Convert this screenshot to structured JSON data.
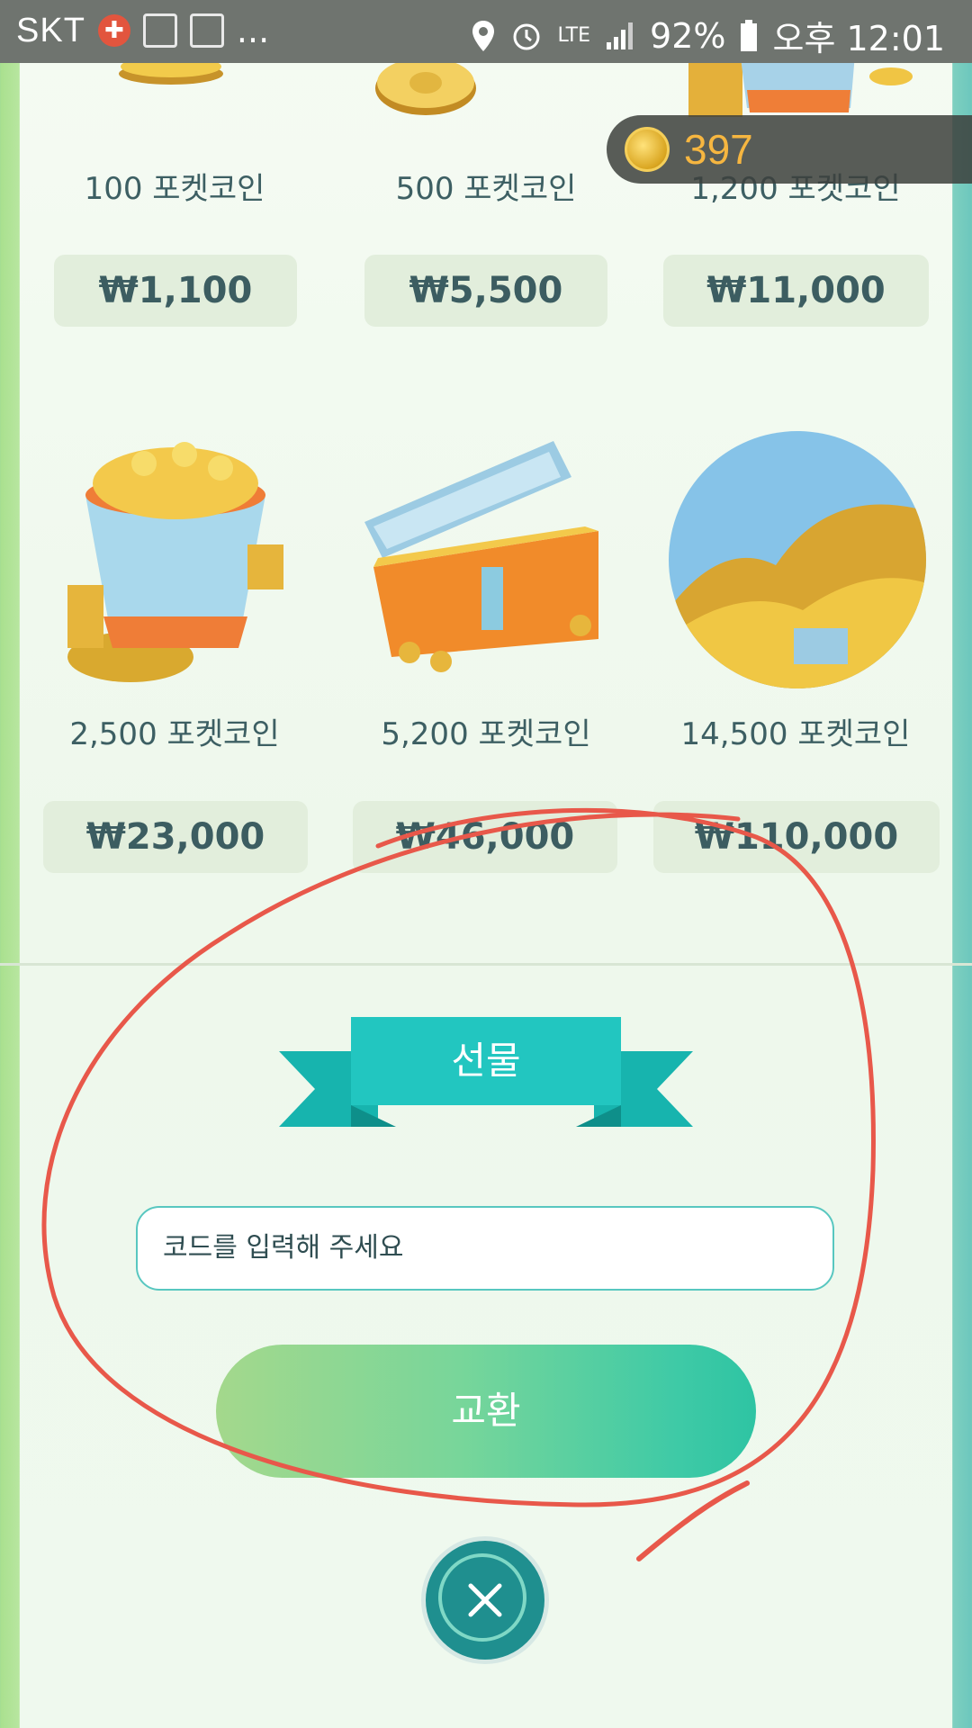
{
  "status_bar": {
    "carrier": "SKT",
    "more": "...",
    "network": "LTE",
    "battery": "92%",
    "time": "오후 12:01"
  },
  "coin_balance": "397",
  "products": [
    {
      "label": "100 포켓코인",
      "price": "₩1,100"
    },
    {
      "label": "500 포켓코인",
      "price": "₩5,500"
    },
    {
      "label": "1,200 포켓코인",
      "price": "₩11,000"
    },
    {
      "label": "2,500 포켓코인",
      "price": "₩23,000"
    },
    {
      "label": "5,200 포켓코인",
      "price": "₩46,000"
    },
    {
      "label": "14,500 포켓코인",
      "price": "₩110,000"
    }
  ],
  "gift": {
    "title": "선물",
    "code_placeholder": "코드를 입력해 주세요",
    "exchange_label": "교환"
  },
  "colors": {
    "teal": "#22c6c0",
    "price_bg": "#e2eedc",
    "coin_text": "#f6b640",
    "annotation": "#e8584a"
  }
}
